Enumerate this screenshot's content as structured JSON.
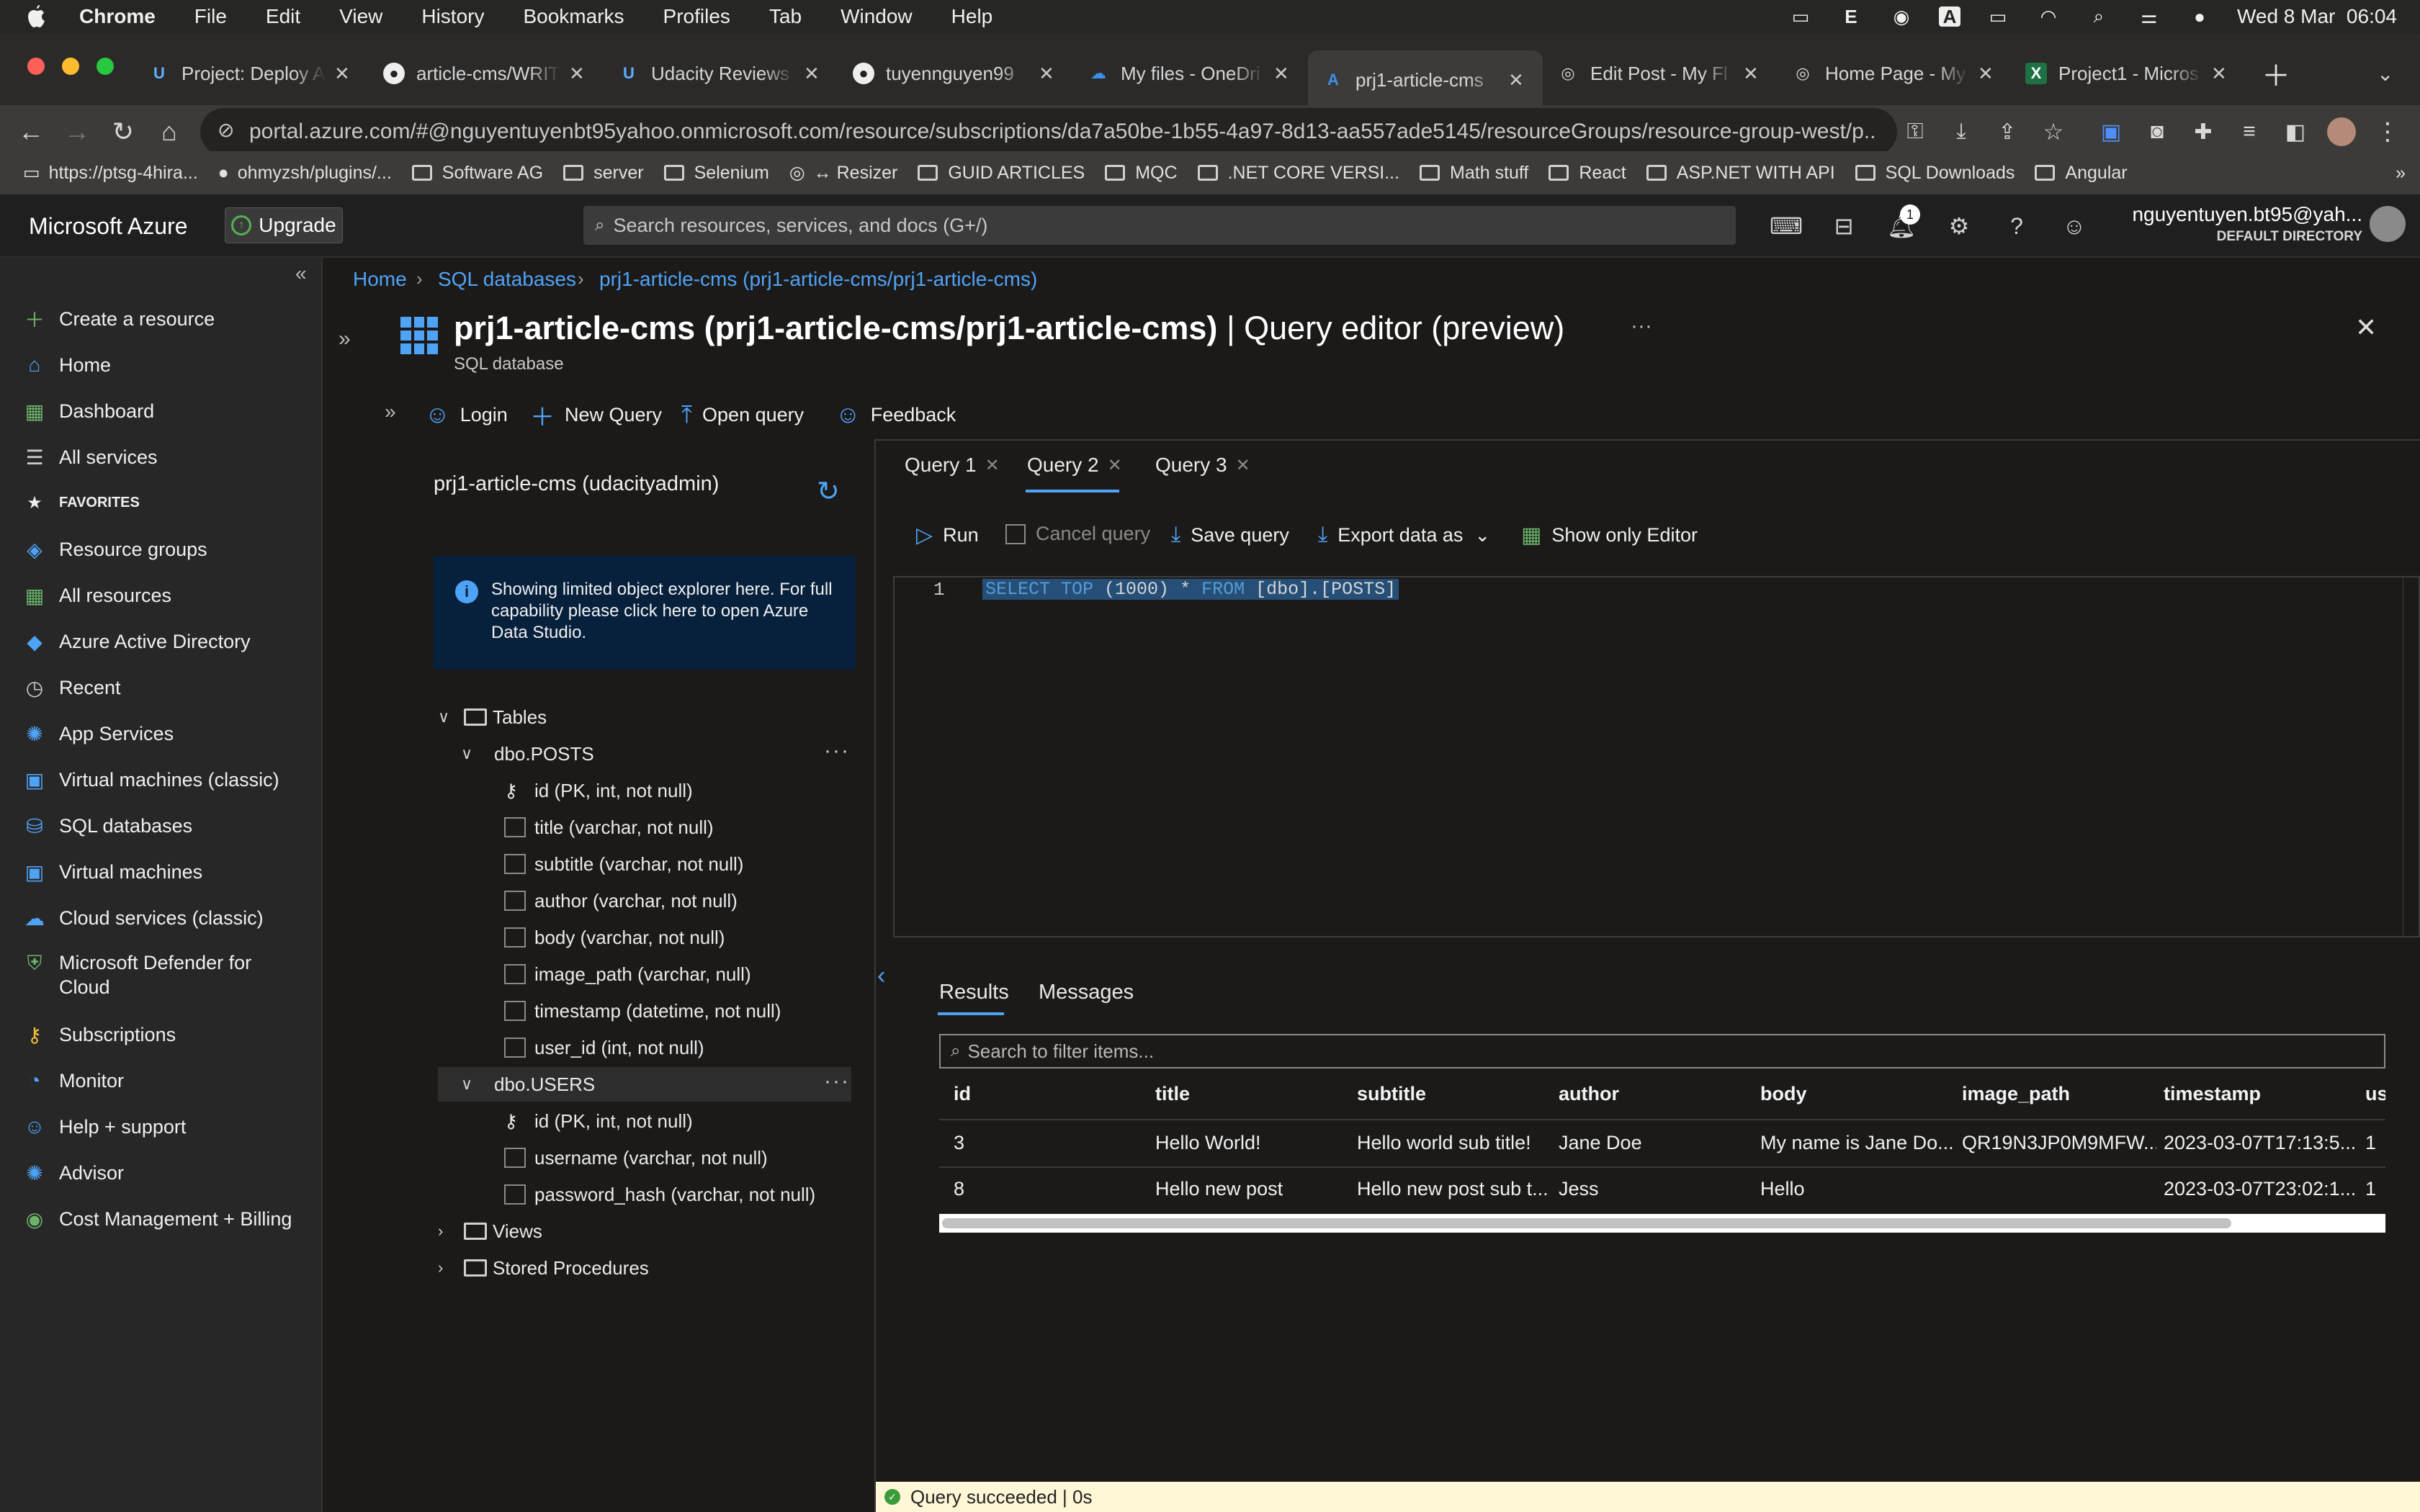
{
  "menubar": {
    "app": "Chrome",
    "items": [
      "File",
      "Edit",
      "View",
      "History",
      "Bookmarks",
      "Profiles",
      "Tab",
      "Window",
      "Help"
    ],
    "clock": "Wed 8 Mar  06:04"
  },
  "tabs": [
    {
      "label": "Project: Deploy A",
      "icon": "udacity-icon"
    },
    {
      "label": "article-cms/WRIT",
      "icon": "github-icon"
    },
    {
      "label": "Udacity Reviews",
      "icon": "udacity-icon"
    },
    {
      "label": "tuyennguyen99",
      "icon": "github-icon"
    },
    {
      "label": "My files - OneDri",
      "icon": "onedrive-icon"
    },
    {
      "label": "prj1-article-cms",
      "icon": "azure-icon"
    },
    {
      "label": "Edit Post - My Fl",
      "icon": "globe-icon"
    },
    {
      "label": "Home Page - My",
      "icon": "globe-icon"
    },
    {
      "label": "Project1 - Micros",
      "icon": "excel-icon"
    }
  ],
  "address": "portal.azure.com/#@nguyentuyenbt95yahoo.onmicrosoft.com/resource/subscriptions/da7a50be-1b55-4a97-8d13-aa557ade5145/resourceGroups/resource-group-west/p...",
  "bookmarks": [
    "https://ptsg-4hira...",
    "ohmyzsh/plugins/...",
    "Software AG",
    "server",
    "Selenium",
    "↔ Resizer",
    "GUID ARTICLES",
    "MQC",
    ".NET CORE VERSI...",
    "Math stuff",
    "React",
    "ASP.NET WITH API",
    "SQL Downloads",
    "Angular"
  ],
  "azure": {
    "brand": "Microsoft Azure",
    "upgrade": "Upgrade",
    "search_placeholder": "Search resources, services, and docs (G+/)",
    "notification_count": "1",
    "account_email": "nguyentuyen.bt95@yah...",
    "account_dir": "DEFAULT DIRECTORY"
  },
  "sidebar": {
    "items": [
      {
        "label": "Create a resource",
        "icon": "plus-icon"
      },
      {
        "label": "Home",
        "icon": "home-icon"
      },
      {
        "label": "Dashboard",
        "icon": "dashboard-icon"
      },
      {
        "label": "All services",
        "icon": "list-icon"
      },
      {
        "label": "FAVORITES",
        "icon": "star-icon"
      },
      {
        "label": "Resource groups",
        "icon": "resource-groups-icon"
      },
      {
        "label": "All resources",
        "icon": "grid-icon"
      },
      {
        "label": "Azure Active Directory",
        "icon": "aad-icon"
      },
      {
        "label": "Recent",
        "icon": "clock-icon"
      },
      {
        "label": "App Services",
        "icon": "app-services-icon"
      },
      {
        "label": "Virtual machines (classic)",
        "icon": "vm-classic-icon"
      },
      {
        "label": "SQL databases",
        "icon": "sql-icon"
      },
      {
        "label": "Virtual machines",
        "icon": "vm-icon"
      },
      {
        "label": "Cloud services (classic)",
        "icon": "cloud-icon"
      },
      {
        "label": "Microsoft Defender for",
        "label2": "Cloud",
        "icon": "shield-icon"
      },
      {
        "label": "Subscriptions",
        "icon": "key-icon"
      },
      {
        "label": "Monitor",
        "icon": "monitor-icon"
      },
      {
        "label": "Help + support",
        "icon": "help-person-icon"
      },
      {
        "label": "Advisor",
        "icon": "advisor-icon"
      },
      {
        "label": "Cost Management + Billing",
        "icon": "cost-icon"
      }
    ]
  },
  "breadcrumb": [
    "Home",
    "SQL databases",
    "prj1-article-cms (prj1-article-cms/prj1-article-cms)"
  ],
  "page": {
    "title_main": "prj1-article-cms (prj1-article-cms/prj1-article-cms)",
    "title_rest": " | Query editor (preview)",
    "subtitle": "SQL database",
    "more": "···"
  },
  "toolbar": {
    "login": "Login",
    "new_query": "New Query",
    "open_query": "Open query",
    "feedback": "Feedback"
  },
  "explorer": {
    "title": "prj1-article-cms (udacityadmin)",
    "info": "Showing limited object explorer here. For full capability please click here to open Azure Data Studio.",
    "tables": "Tables",
    "posts": "dbo.POSTS",
    "posts_cols": [
      "id (PK, int, not null)",
      "title (varchar, not null)",
      "subtitle (varchar, not null)",
      "author (varchar, not null)",
      "body (varchar, not null)",
      "image_path (varchar, null)",
      "timestamp (datetime, not null)",
      "user_id (int, not null)"
    ],
    "users": "dbo.USERS",
    "users_cols": [
      "id (PK, int, not null)",
      "username (varchar, not null)",
      "password_hash (varchar, not null)"
    ],
    "views": "Views",
    "procs": "Stored Procedures"
  },
  "query_tabs": [
    "Query 1",
    "Query 2",
    "Query 3"
  ],
  "editor_toolbar": {
    "run": "Run",
    "cancel": "Cancel query",
    "save": "Save query",
    "export": "Export data as",
    "show_only": "Show only Editor"
  },
  "editor": {
    "line": "1",
    "kw1": "SELECT",
    "kw2": "TOP",
    "mid": " (1000) * ",
    "kw3": "FROM",
    "tail": " [dbo].[POSTS]"
  },
  "results": {
    "tabs": [
      "Results",
      "Messages"
    ],
    "filter_placeholder": "Search to filter items...",
    "columns": [
      "id",
      "title",
      "subtitle",
      "author",
      "body",
      "image_path",
      "timestamp",
      "us"
    ],
    "rows": [
      [
        "3",
        "Hello World!",
        "Hello world sub title!",
        "Jane Doe",
        "My name is Jane Do...",
        "QR19N3JP0M9MFW...",
        "2023-03-07T17:13:5...",
        "1"
      ],
      [
        "8",
        "Hello new post",
        "Hello new post sub t...",
        "Jess",
        "Hello",
        "",
        "2023-03-07T23:02:1...",
        "1"
      ]
    ]
  },
  "status": "Query succeeded | 0s"
}
